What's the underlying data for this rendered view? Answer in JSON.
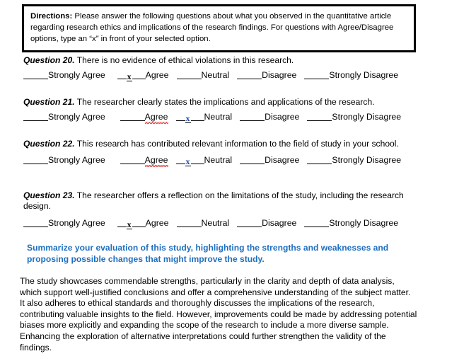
{
  "directions": {
    "label": "Directions:",
    "body": " Please answer the following questions about what you observed in the quantitative article regarding research ethics and implications of the research findings. For questions with Agree/Disagree options, type an “x” in front of your selected option."
  },
  "option_labels": {
    "strongly_agree": "Strongly Agree",
    "agree": "Agree",
    "neutral": "Neutral",
    "disagree": "Disagree",
    "strongly_disagree": "Strongly Disagree"
  },
  "mark_character": "x",
  "questions": [
    {
      "label": "Question 20.",
      "text": " There is no evidence of ethical violations in this research.",
      "selected": "agree"
    },
    {
      "label": "Question 21.",
      "text": "  The researcher clearly states the implications and applications of the research.",
      "selected": "neutral"
    },
    {
      "label": "Question 22.",
      "text": " This research has contributed relevant information to the field of study in your school.",
      "selected": "neutral"
    },
    {
      "label": "Question 23.",
      "text": " The researcher offers a reflection on the limitations of the study, including the research design.",
      "selected": "agree"
    }
  ],
  "summarize_prompt": "Summarize your evaluation of this study, highlighting the strengths and weaknesses and proposing possible changes that might improve the study.",
  "response_text": "The study showcases commendable strengths, particularly in the clarity and depth of data analysis, which support well-justified conclusions and offer a comprehensive understanding of the subject matter. It also adheres to ethical standards and thoroughly discusses the implications of the research, contributing valuable insights to the field. However, improvements could be made by addressing potential biases more explicitly and expanding the scope of the research to include a more diverse sample. Enhancing the exploration of alternative interpretations could further strengthen the validity of the findings.",
  "colors": {
    "summarize_blue": "#1F6FC0",
    "mark_blue": "#1F4E9C",
    "spellcheck_red": "#E02020",
    "border_black": "#000000"
  }
}
